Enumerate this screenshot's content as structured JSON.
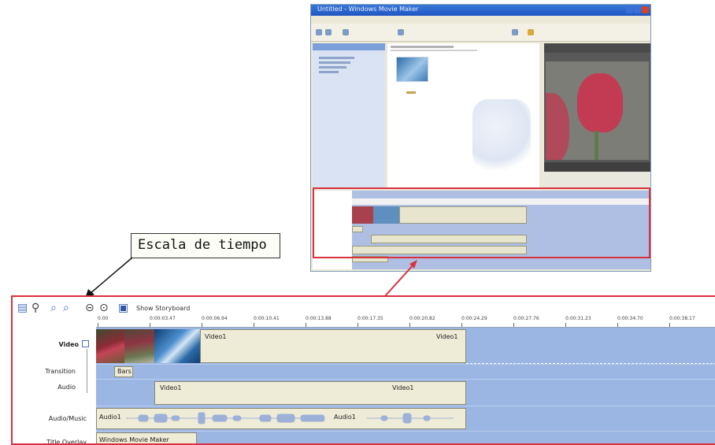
{
  "callout": {
    "label": "Escala de tiempo"
  },
  "window": {
    "title": "Untitled - Windows Movie Maker"
  },
  "toolbar": {
    "show_storyboard_label": "Show Storyboard"
  },
  "ruler": {
    "ticks": [
      "0.00",
      "0:00:03.47",
      "0:00:06.94",
      "0:00:10.41",
      "0:00:13.88",
      "0:00:17.35",
      "0:00:20.82",
      "0:00:24.29",
      "0:00:27.76",
      "0:00:31.23",
      "0:00:34.70",
      "0:00:38.17"
    ]
  },
  "tracks": {
    "video": {
      "label": "Video"
    },
    "transition": {
      "label": "Transition"
    },
    "audio": {
      "label": "Audio"
    },
    "audio_music": {
      "label": "Audio/Music"
    },
    "title_overlay": {
      "label": "Title Overlay"
    }
  },
  "clips": {
    "video_start": "Video1",
    "video_end": "Video1",
    "transition": "Bars",
    "audio_start": "Video1",
    "audio_end": "Video1",
    "audio_music_start": "Audio1",
    "audio_music_mid": "Audio1",
    "title": "Windows Movie Maker"
  },
  "colors": {
    "highlight": "#d9323e",
    "track_bg": "#9cb6e4",
    "clip_bg": "#eeebd6"
  }
}
